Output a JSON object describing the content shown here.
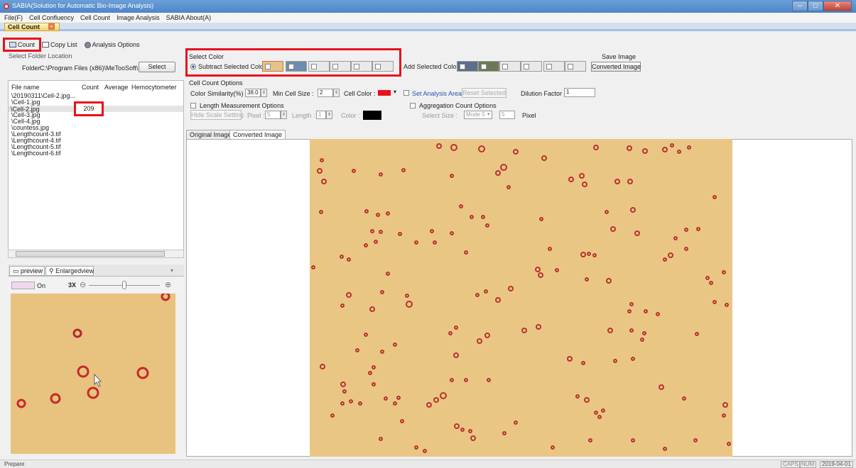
{
  "window": {
    "title": "SABIA(Solution for Automatic Bio-Image Analysis)"
  },
  "menu": {
    "items": [
      "File(F)",
      "Cell Confluency",
      "Cell Count",
      "Image Analysis",
      "SABIA About(A)"
    ]
  },
  "doc_tab": {
    "label": "Cell Count"
  },
  "toolbar": {
    "count": "Count",
    "copy_list": "Copy List",
    "analysis_options": "Analysis Options"
  },
  "folder": {
    "section_label": "Select Folder Location",
    "label": "Folder",
    "path": "C:\\Program Files (x86)\\MeTooSoft\\",
    "select_button": "Select"
  },
  "file_list": {
    "headers": {
      "name": "File name",
      "count": "Count",
      "average": "Average",
      "hemocytometer": "Hemocytometer"
    },
    "rows": [
      {
        "name": "\\20190311\\Cell-2.jpg...",
        "count": ""
      },
      {
        "name": "\\Cell-1.jpg",
        "count": ""
      },
      {
        "name": "\\Cell-2.jpg",
        "count": "209"
      },
      {
        "name": "\\Cell-3.jpg",
        "count": ""
      },
      {
        "name": "\\Cell-4.jpg",
        "count": ""
      },
      {
        "name": "\\countess.jpg",
        "count": ""
      },
      {
        "name": "\\Lengthcount-3.tif",
        "count": ""
      },
      {
        "name": "\\Lengthcount-4.tif",
        "count": ""
      },
      {
        "name": "\\Lengthcount-5.tif",
        "count": ""
      },
      {
        "name": "\\Lengthcount-6.tif",
        "count": ""
      }
    ]
  },
  "preview": {
    "tab_preview": "preview",
    "tab_enlarged": "Enlargedview",
    "toggle_label": "On",
    "zoom_level": "3X",
    "zoom_slider_fraction": 0.5
  },
  "select_color": {
    "label": "Select Color",
    "subtract_label": "Subtract Selected Color",
    "add_label": "Add Selected Color"
  },
  "save_image": {
    "label": "Save Image",
    "button": "Converted Image"
  },
  "cell_count_options": {
    "label": "Cell Count Options",
    "similarity_label": "Color Similarity(%) :",
    "similarity_value": "38.0",
    "min_size_label": "Min Cell Size :",
    "min_size_value": "2",
    "cell_color_label": "Cell Color :",
    "cell_color": "#e8101a",
    "set_area_label": "Set Analysis Area",
    "reset_button": "Reset Selected",
    "dilution_label": "Dilution Factor :",
    "dilution_value": "1"
  },
  "length_options": {
    "label": "Length Measurement Options",
    "hide_button": "Hide Scale Setting",
    "pixel_label": "Pixel :",
    "pixel_value": "5",
    "length_label": "Length :",
    "length_value": "1",
    "color_label": "Color :"
  },
  "aggregation": {
    "label": "Aggregation Count Options",
    "select_size_label": "Select Size :",
    "mode_value": "Mode 5",
    "size_value": "5",
    "pixel_unit": "Pixel"
  },
  "image_tabs": {
    "original": "Original Image",
    "converted": "Converted Image"
  },
  "status": {
    "text": "Prepare",
    "caps": "CAPS",
    "num": "NUM",
    "date": "2019-04-01"
  }
}
